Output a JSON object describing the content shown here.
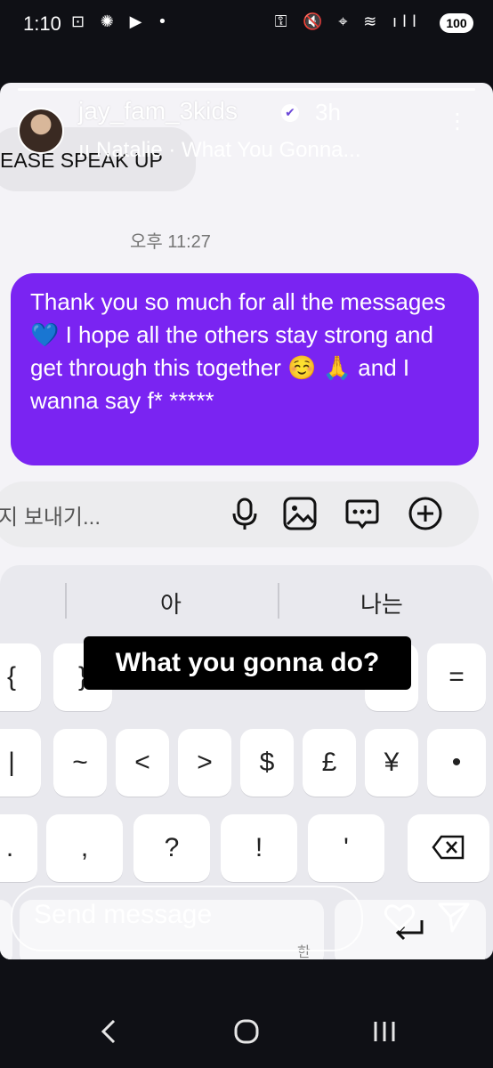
{
  "status_bar": {
    "time": "1:10",
    "left_icons": "⊡ ✺ ▶ •",
    "right_icons": "⚿ 🔇 ⌖ ≋ ıll",
    "battery": "100"
  },
  "story": {
    "username": "jay_fam_3kids",
    "verified_icon": "✔",
    "time_ago": "3h",
    "music": "ıı Natalie · What You Gonna...",
    "previous_message": "EASE SPEAK UP",
    "timestamp": "오후 11:27",
    "message": "Thank you so much for all the messages 💙 I hope all the others stay strong and get through this together ☺️ 🙏 and I wanna say f* *****",
    "compose_placeholder": "지 보내기...",
    "caption": "What you gonna do?",
    "reply_placeholder": "Send message"
  },
  "keyboard": {
    "suggestions": [
      "아",
      "나는"
    ],
    "row1": [
      "{",
      "}",
      "[",
      "]",
      "<",
      ">",
      "^",
      "="
    ],
    "row2": [
      "|",
      "~",
      "<",
      ">",
      "$",
      "£",
      "¥",
      "•"
    ],
    "row3": [
      ".",
      ",",
      "?",
      "!",
      "'"
    ],
    "bottom_hint": "한"
  },
  "colors": {
    "bubble": "#7a24f2",
    "story_bg": "#f4f3f7",
    "keyboard_bg": "#e9e9ee"
  }
}
